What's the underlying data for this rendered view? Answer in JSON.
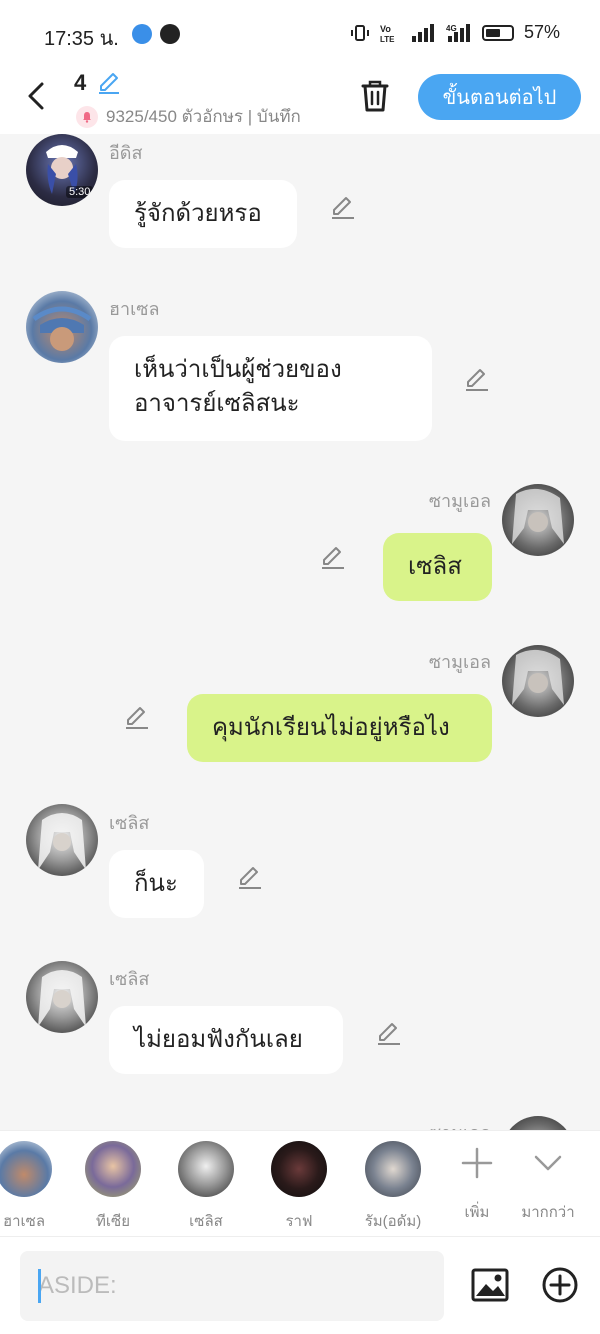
{
  "status_bar": {
    "time": "17:35 น.",
    "battery": "57%",
    "battery_level": 0.57
  },
  "header": {
    "title": "4",
    "subtitle": "9325/450 ตัวอักษร | บันทึก",
    "next_label": "ขั้นตอนต่อไป"
  },
  "messages": [
    {
      "side": "left",
      "name": "อีดิส",
      "text": "รู้จักด้วยหรอ",
      "avatar_badge": "5:30"
    },
    {
      "side": "left",
      "name": "ฮาเซล",
      "text_lines": [
        "เห็นว่าเป็นผู้ช่วยของ",
        "อาจารย์เซลิสนะ"
      ]
    },
    {
      "side": "right",
      "name": "ซามูเอล",
      "text": "เซลิส"
    },
    {
      "side": "right",
      "name": "ซามูเอล",
      "text": "คุมนักเรียนไม่อยู่หรือไง"
    },
    {
      "side": "left",
      "name": "เซลิส",
      "text": "ก็นะ"
    },
    {
      "side": "left",
      "name": "เซลิส",
      "text": "ไม่ยอมฟังกันเลย"
    },
    {
      "side": "right",
      "name": "ซามูเอล"
    }
  ],
  "characters": [
    {
      "label": "ฮาเซล"
    },
    {
      "label": "ทีเซีย"
    },
    {
      "label": "เซลิส"
    },
    {
      "label": "ราฟ"
    },
    {
      "label": "รัม(อดัม)"
    }
  ],
  "tools": {
    "add_label": "เพิ่ม",
    "more_label": "มากกว่า"
  },
  "input": {
    "placeholder": "ASIDE:"
  },
  "colors": {
    "accent": "#4aa6f2",
    "my_bubble": "#d9f38a",
    "other_bubble": "#ffffff"
  }
}
